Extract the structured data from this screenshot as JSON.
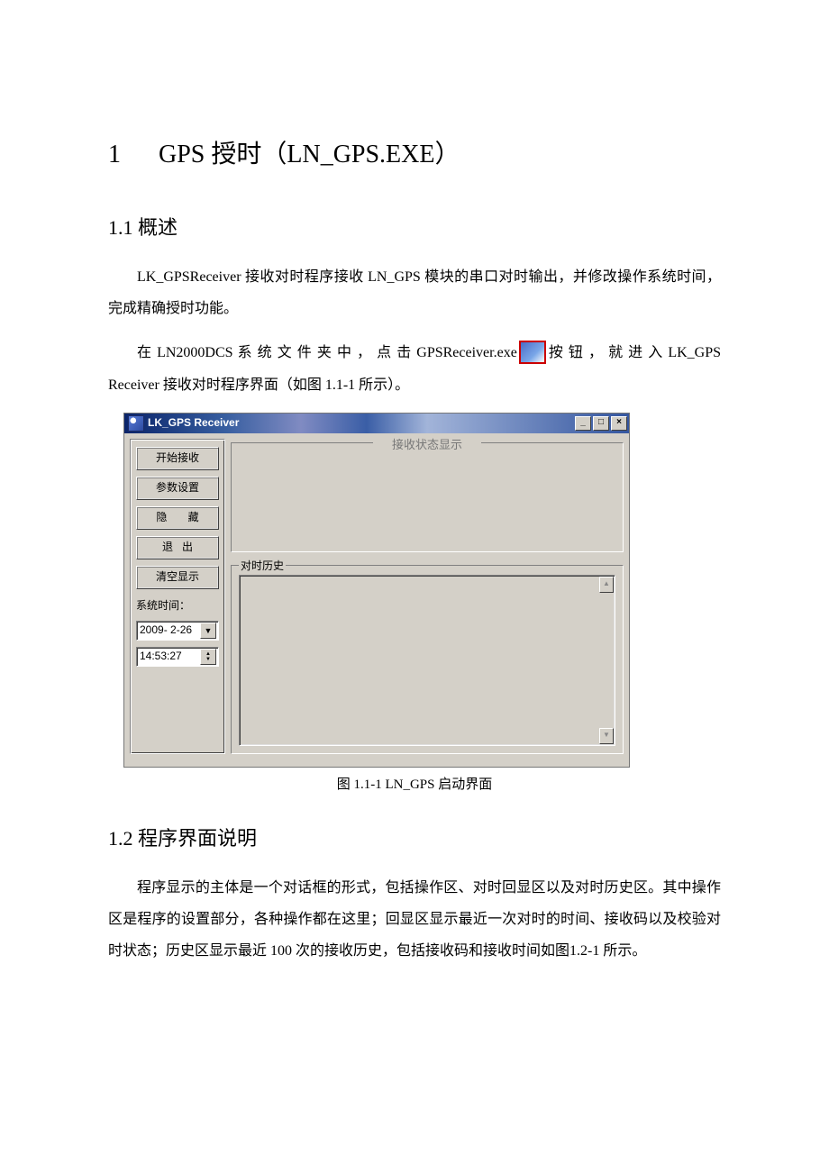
{
  "doc": {
    "section_number": "1",
    "section_title": "GPS 授时（LN_GPS.EXE）",
    "sub1_number": "1.1",
    "sub1_title": "概述",
    "para1": "LK_GPSReceiver 接收对时程序接收 LN_GPS 模块的串口对时输出，并修改操作系统时间，完成精确授时功能。",
    "para2a": "在 LN2000DCS 系 统 文 件 夹 中 ， 点 击 GPSReceiver.exe",
    "para2b": "按 钮 ， 就 进 入 LK_GPS Receiver 接收对时程序界面（如图 1.1-1 所示）。",
    "caption1": "图 1.1-1   LN_GPS 启动界面",
    "sub2_number": "1.2",
    "sub2_title": "程序界面说明",
    "para3": "程序显示的主体是一个对话框的形式，包括操作区、对时回显区以及对时历史区。其中操作区是程序的设置部分，各种操作都在这里；回显区显示最近一次对时的时间、接收码以及校验对时状态；历史区显示最近 100 次的接收历史，包括接收码和接收时间如图1.2-1 所示。"
  },
  "win": {
    "title": "LK_GPS Receiver",
    "buttons": {
      "start": "开始接收",
      "params": "参数设置",
      "hide": "隐  藏",
      "exit": "退出",
      "clear": "清空显示"
    },
    "systime_label": "系统时间：",
    "date": "2009- 2-26",
    "time": "14:53:27",
    "status_label": "接收状态显示",
    "history_label": "对时历史"
  }
}
